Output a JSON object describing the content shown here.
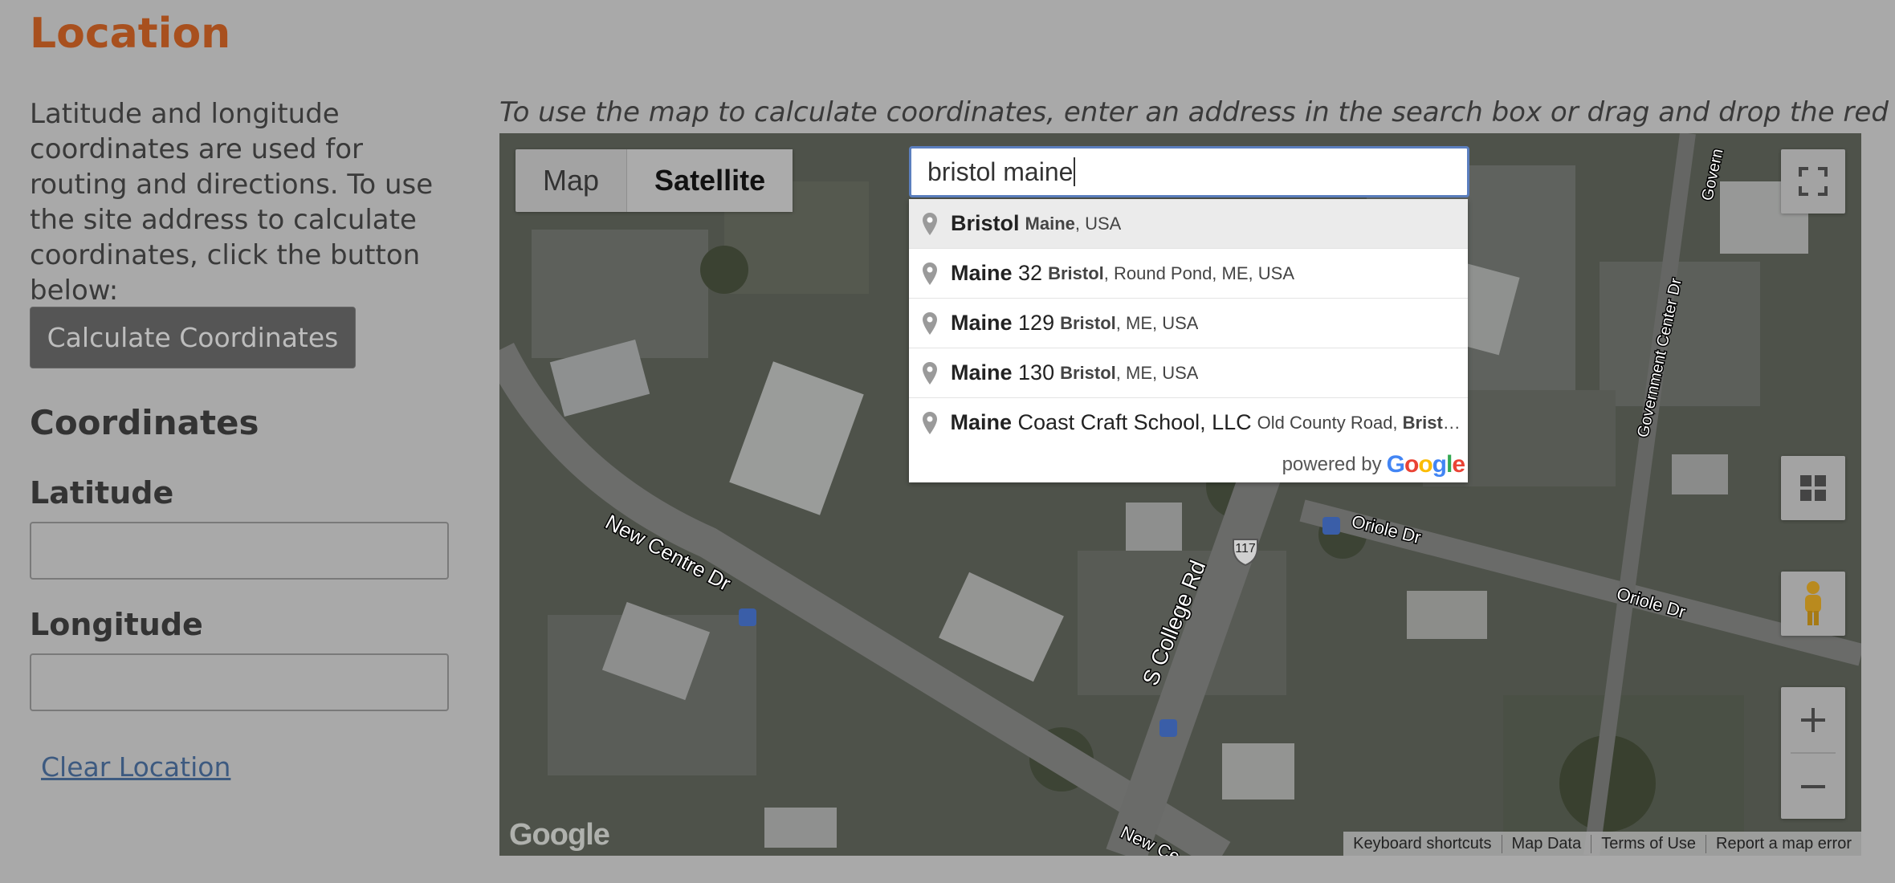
{
  "section_title": "Location",
  "description": "Latitude and longitude coordinates are used for routing and directions. To use the site address to calculate coordinates, click the button below:",
  "calculate_button": "Calculate Coordinates",
  "coordinates_title": "Coordinates",
  "latitude": {
    "label": "Latitude",
    "value": ""
  },
  "longitude": {
    "label": "Longitude",
    "value": ""
  },
  "clear_link": "Clear Location",
  "map_instruction": "To use the map to calculate coordinates, enter an address in the search box or drag and drop the red pin.",
  "map": {
    "type_map": "Map",
    "type_satellite": "Satellite",
    "search_value": "bristol maine",
    "suggestions": [
      {
        "main": "Bristol",
        "rest_main": "",
        "sec_bold": "Maine",
        "sec": ", USA"
      },
      {
        "main": "Maine",
        "rest_main": " 32",
        "sec_bold": "Bristol",
        "sec": ", Round Pond, ME, USA"
      },
      {
        "main": "Maine",
        "rest_main": " 129",
        "sec_bold": "Bristol",
        "sec": ", ME, USA"
      },
      {
        "main": "Maine",
        "rest_main": " 130",
        "sec_bold": "Bristol",
        "sec": ", ME, USA"
      },
      {
        "main": "Maine",
        "rest_main": " Coast Craft School, LLC",
        "sec_bold": "",
        "sec": "Old County Road, ",
        "sec_bold2": "Bristo…"
      }
    ],
    "powered_by": "powered by",
    "powered_brand": "Google",
    "logo": "Google",
    "footer": [
      "Keyboard shortcuts",
      "Map Data",
      "Terms of Use",
      "Report a map error"
    ],
    "street_labels": [
      "New Centre Dr",
      "S College Rd",
      "Oriole Dr",
      "Oriole Dr",
      "Government Center Dr",
      "Govern",
      "New Ce",
      "117"
    ]
  }
}
